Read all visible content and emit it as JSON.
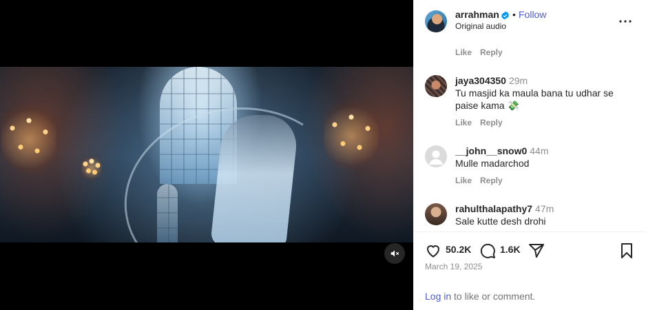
{
  "post": {
    "username": "arrahman",
    "separator": "•",
    "follow_label": "Follow",
    "audio": "Original audio"
  },
  "top_actions": {
    "like": "Like",
    "reply": "Reply"
  },
  "comments": [
    {
      "username": "jaya304350",
      "time": "29m",
      "text": "Tu masjid ka maula bana tu udhar se paise kama 💸",
      "like": "Like",
      "reply": "Reply"
    },
    {
      "username": "__john__snow0",
      "time": "44m",
      "text": "Mulle madarchod",
      "like": "Like",
      "reply": "Reply"
    },
    {
      "username": "rahulthalapathy7",
      "time": "47m",
      "text": "Sale kutte desh drohi"
    }
  ],
  "stats": {
    "likes": "50.2K",
    "comments": "1.6K"
  },
  "date": "March 19, 2025",
  "login": {
    "link": "Log in",
    "rest": " to like or comment."
  },
  "colors": {
    "accent": "#4f5bd5",
    "verified": "#0095f6",
    "muted": "#8e8e8e"
  },
  "icons": [
    "mute-icon",
    "verified-icon",
    "more-icon",
    "heart-icon",
    "comment-icon",
    "share-icon",
    "bookmark-icon"
  ]
}
